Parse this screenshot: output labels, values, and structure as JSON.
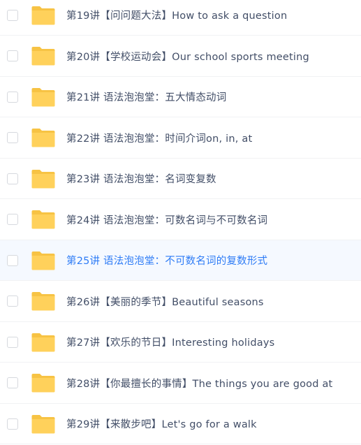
{
  "theme": {
    "folder_color": "#ffd15b",
    "folder_tab_color": "#f7c344",
    "text_color": "#424e67",
    "highlight_color": "#2e7cf6",
    "hover_background": "#f5f9ff"
  },
  "files": [
    {
      "name": "第19讲【问问题大法】How to ask a question",
      "icon": "folder-icon",
      "highlighted": false
    },
    {
      "name": "第20讲【学校运动会】Our school sports meeting",
      "icon": "folder-icon",
      "highlighted": false
    },
    {
      "name": "第21讲 语法泡泡堂：五大情态动词",
      "icon": "folder-icon",
      "highlighted": false
    },
    {
      "name": "第22讲 语法泡泡堂：时间介词on, in, at",
      "icon": "folder-icon",
      "highlighted": false
    },
    {
      "name": "第23讲 语法泡泡堂：名词变复数",
      "icon": "folder-icon",
      "highlighted": false
    },
    {
      "name": "第24讲 语法泡泡堂：可数名词与不可数名词",
      "icon": "folder-icon",
      "highlighted": false
    },
    {
      "name": "第25讲 语法泡泡堂：不可数名词的复数形式",
      "icon": "folder-icon",
      "highlighted": true
    },
    {
      "name": "第26讲【美丽的季节】Beautiful seasons",
      "icon": "folder-icon",
      "highlighted": false
    },
    {
      "name": "第27讲【欢乐的节日】Interesting holidays",
      "icon": "folder-icon",
      "highlighted": false
    },
    {
      "name": "第28讲【你最擅长的事情】The things you are good at",
      "icon": "folder-icon",
      "highlighted": false
    },
    {
      "name": "第29讲【来散步吧】Let's go for a walk",
      "icon": "folder-icon",
      "highlighted": false
    }
  ]
}
